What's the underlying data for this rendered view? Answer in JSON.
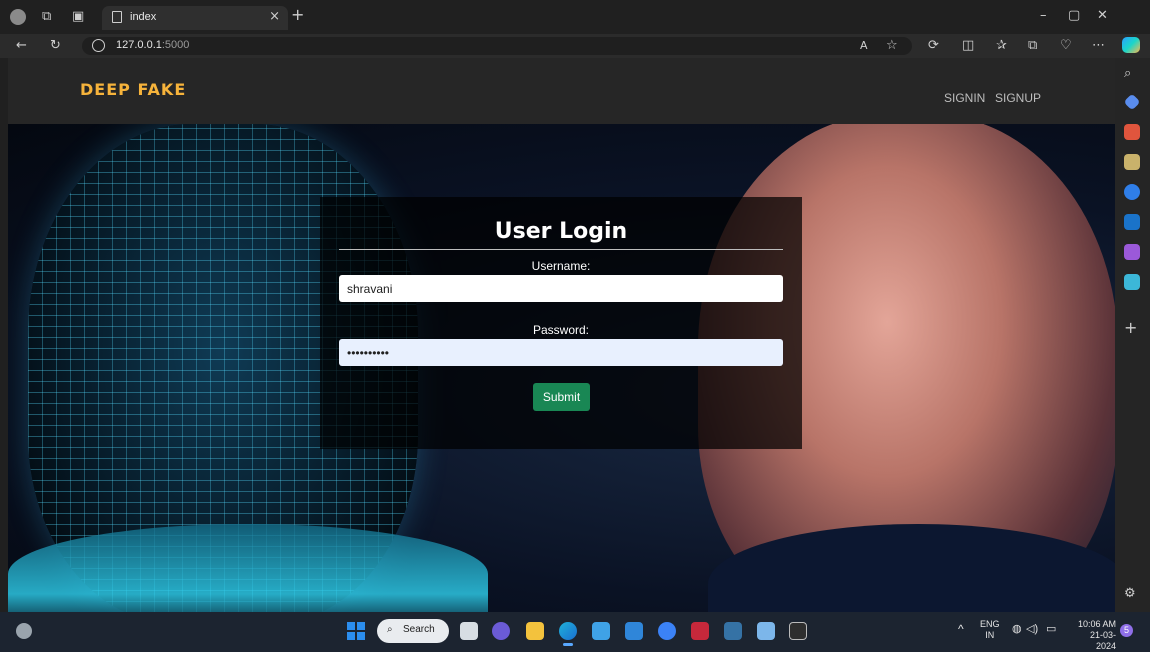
{
  "browser": {
    "tab_title": "index",
    "tab_close": "×",
    "new_tab": "+",
    "url_host": "127.0.0.1",
    "url_port": ":5000",
    "window_min": "–",
    "window_max": "▢",
    "window_close": "✕"
  },
  "page": {
    "brand": "DEEP FAKE",
    "nav": {
      "signin": "SIGNIN",
      "signup": "SIGNUP"
    },
    "login": {
      "title": "User Login",
      "username_label": "Username:",
      "username_value": "shravani",
      "password_label": "Password:",
      "password_value": "••••••••••",
      "submit_label": "Submit"
    }
  },
  "taskbar": {
    "search_label": "Search",
    "lang_top": "ENG",
    "lang_bottom": "IN",
    "time": "10:06 AM",
    "date": "21-03-2024",
    "notification_count": "5"
  },
  "colors": {
    "brand": "#f6b33b",
    "submit": "#198754",
    "navbar": "#262626"
  }
}
